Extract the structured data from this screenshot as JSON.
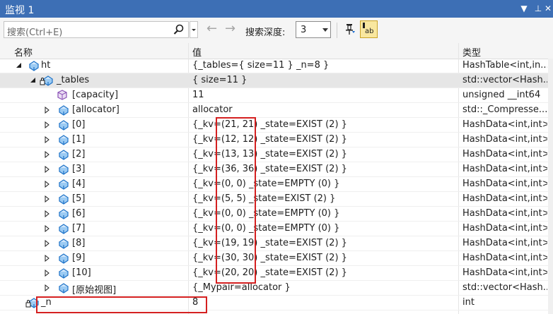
{
  "window": {
    "title": "监视 1",
    "dropdown_icon": "▼",
    "pin_icon": "⊥",
    "close_icon": "✕"
  },
  "toolbar": {
    "search_placeholder": "搜索(Ctrl+E)",
    "depth_label": "搜索深度:",
    "depth_value": "3",
    "back_icon": "←",
    "forward_icon": "→",
    "hex_label": "ab"
  },
  "columns": {
    "name": "名称",
    "value": "值",
    "type": "类型"
  },
  "rows": [
    {
      "name": "ht",
      "value": "{_tables={ size=11 } _n=8 }",
      "type": "HashTable<int,in..."
    },
    {
      "name": "_tables",
      "value": "{ size=11 }",
      "type": "std::vector<Hash..."
    },
    {
      "name": "[capacity]",
      "value": "11",
      "type": "unsigned __int64"
    },
    {
      "name": "[allocator]",
      "value": "allocator",
      "type": "std::_Compresse..."
    },
    {
      "name": "[0]",
      "value": "{_kv=(21, 21) _state=EXIST (2) }",
      "type": "HashData<int,int>"
    },
    {
      "name": "[1]",
      "value": "{_kv=(12, 12) _state=EXIST (2) }",
      "type": "HashData<int,int>"
    },
    {
      "name": "[2]",
      "value": "{_kv=(13, 13) _state=EXIST (2) }",
      "type": "HashData<int,int>"
    },
    {
      "name": "[3]",
      "value": "{_kv=(36, 36) _state=EXIST (2) }",
      "type": "HashData<int,int>"
    },
    {
      "name": "[4]",
      "value": "{_kv=(0, 0) _state=EMPTY (0) }",
      "type": "HashData<int,int>"
    },
    {
      "name": "[5]",
      "value": "{_kv=(5, 5) _state=EXIST (2) }",
      "type": "HashData<int,int>"
    },
    {
      "name": "[6]",
      "value": "{_kv=(0, 0) _state=EMPTY (0) }",
      "type": "HashData<int,int>"
    },
    {
      "name": "[7]",
      "value": "{_kv=(0, 0) _state=EMPTY (0) }",
      "type": "HashData<int,int>"
    },
    {
      "name": "[8]",
      "value": "{_kv=(19, 19) _state=EXIST (2) }",
      "type": "HashData<int,int>"
    },
    {
      "name": "[9]",
      "value": "{_kv=(30, 30) _state=EXIST (2) }",
      "type": "HashData<int,int>"
    },
    {
      "name": "[10]",
      "value": "{_kv=(20, 20) _state=EXIST (2) }",
      "type": "HashData<int,int>"
    },
    {
      "name": "[原始视图]",
      "value": "{_Mypair=allocator }",
      "type": "std::vector<Hash..."
    },
    {
      "name": "_n",
      "value": "8",
      "type": "int"
    }
  ],
  "colors": {
    "title_bg": "#3d6fb5",
    "highlight": "#d42020"
  }
}
